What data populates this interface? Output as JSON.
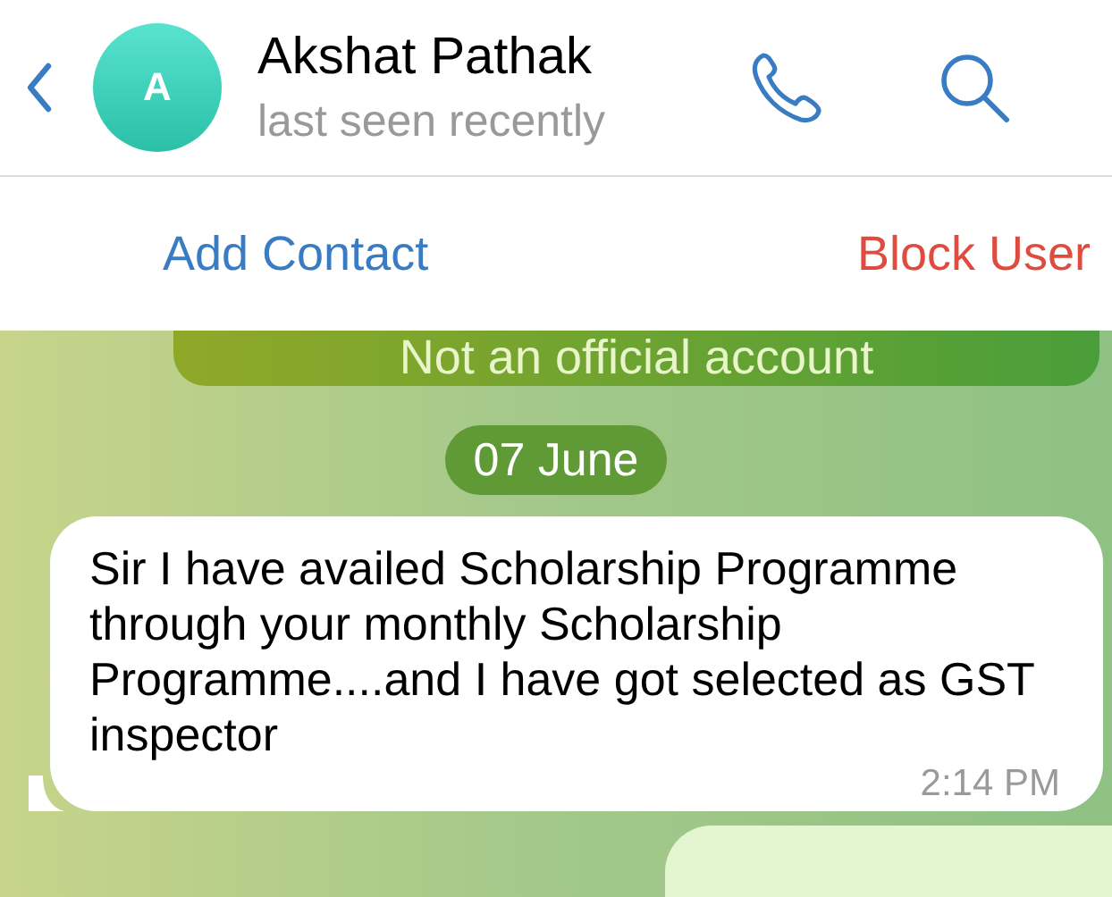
{
  "header": {
    "avatar_initial": "A",
    "name": "Akshat Pathak",
    "status": "last seen recently"
  },
  "actions": [
    {
      "label": "Add Contact",
      "kind": "add"
    },
    {
      "label": "Block User",
      "kind": "block"
    }
  ],
  "notice": "Not an official account",
  "date": "07 June",
  "messages": [
    {
      "kind": "incoming",
      "text": "Sir I have availed Scholarship Programme through your monthly Scholarship Programme....and I have got selected as GST inspector",
      "time": "2:14 PM"
    },
    {
      "kind": "outgoing"
    }
  ]
}
